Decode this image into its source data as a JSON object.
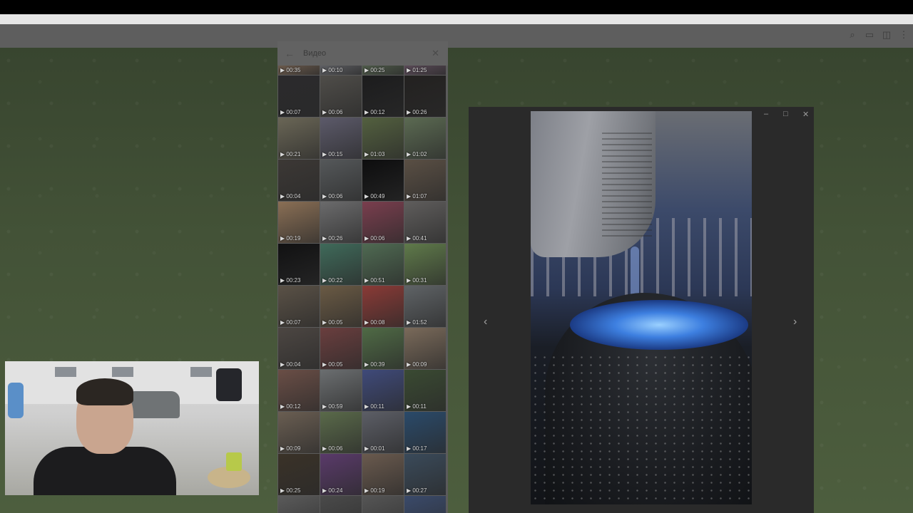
{
  "panel": {
    "title": "Видео",
    "back_icon": "arrow-left-icon",
    "close_icon": "close-icon"
  },
  "videos": [
    {
      "duration": "00:35",
      "color": "#6b5a4c"
    },
    {
      "duration": "00:10",
      "color": "#5e5f63"
    },
    {
      "duration": "00:25",
      "color": "#4f5b4a"
    },
    {
      "duration": "01:25",
      "color": "#5a4a57"
    },
    {
      "duration": "00:07",
      "color": "#2b2a2c"
    },
    {
      "duration": "00:06",
      "color": "#4f4d49"
    },
    {
      "duration": "00:12",
      "color": "#1c1c1d"
    },
    {
      "duration": "00:26",
      "color": "#232120"
    },
    {
      "duration": "00:21",
      "color": "#6a6656"
    },
    {
      "duration": "00:15",
      "color": "#5c5a6a"
    },
    {
      "duration": "01:03",
      "color": "#53603f"
    },
    {
      "duration": "01:02",
      "color": "#5b6a52"
    },
    {
      "duration": "00:04",
      "color": "#3c3835"
    },
    {
      "duration": "00:06",
      "color": "#55585a"
    },
    {
      "duration": "00:49",
      "color": "#0d0d0e"
    },
    {
      "duration": "01:07",
      "color": "#5a4f44"
    },
    {
      "duration": "00:19",
      "color": "#8a6f55"
    },
    {
      "duration": "00:26",
      "color": "#6b6b6c"
    },
    {
      "duration": "00:06",
      "color": "#7a3e4e"
    },
    {
      "duration": "00:41",
      "color": "#5f5d5c"
    },
    {
      "duration": "00:23",
      "color": "#111112"
    },
    {
      "duration": "00:22",
      "color": "#3f6a5a"
    },
    {
      "duration": "00:51",
      "color": "#4f6a52"
    },
    {
      "duration": "00:31",
      "color": "#5f7a4a"
    },
    {
      "duration": "00:07",
      "color": "#5a5146"
    },
    {
      "duration": "00:05",
      "color": "#6a5a44"
    },
    {
      "duration": "00:08",
      "color": "#8a3a36"
    },
    {
      "duration": "01:52",
      "color": "#5f6366"
    },
    {
      "duration": "00:04",
      "color": "#4c4642"
    },
    {
      "duration": "00:05",
      "color": "#6a3e3e"
    },
    {
      "duration": "00:39",
      "color": "#4f6a45"
    },
    {
      "duration": "00:09",
      "color": "#7a6a5a"
    },
    {
      "duration": "00:12",
      "color": "#6a4e46"
    },
    {
      "duration": "00:59",
      "color": "#6b6e70"
    },
    {
      "duration": "00:11",
      "color": "#3f4a7a"
    },
    {
      "duration": "00:11",
      "color": "#3a4a32"
    },
    {
      "duration": "00:09",
      "color": "#6a5e52"
    },
    {
      "duration": "00:06",
      "color": "#5a6a4a"
    },
    {
      "duration": "00:01",
      "color": "#5c5e66"
    },
    {
      "duration": "00:17",
      "color": "#2a4a6a"
    },
    {
      "duration": "00:25",
      "color": "#3a3228"
    },
    {
      "duration": "00:24",
      "color": "#5a3a6a"
    },
    {
      "duration": "00:19",
      "color": "#6a5a4e"
    },
    {
      "duration": "00:27",
      "color": "#3a4a5a"
    },
    {
      "duration": "",
      "color": "#5a5a5a"
    },
    {
      "duration": "",
      "color": "#4a4a4a"
    },
    {
      "duration": "",
      "color": "#555555"
    },
    {
      "duration": "",
      "color": "#3a4a6a"
    }
  ],
  "viewer": {
    "minimize_icon": "minimize-icon",
    "maximize_icon": "maximize-icon",
    "close_icon": "close-icon",
    "prev_icon": "chevron-left-icon",
    "next_icon": "chevron-right-icon",
    "minimize_glyph": "–",
    "maximize_glyph": "□",
    "close_glyph": "✕",
    "prev_glyph": "‹",
    "next_glyph": "›"
  },
  "header_icons": [
    "search-icon",
    "comments-icon",
    "sidebar-icon",
    "more-icon"
  ]
}
